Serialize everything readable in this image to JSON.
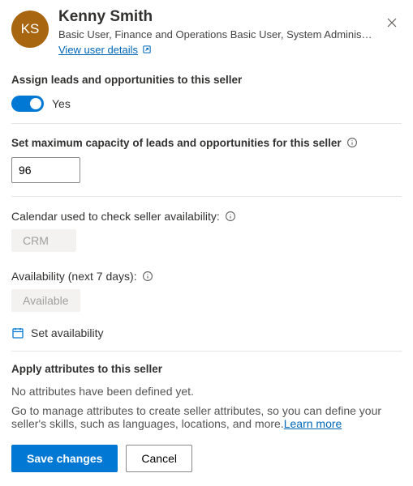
{
  "header": {
    "initials": "KS",
    "name": "Kenny Smith",
    "roles": "Basic User, Finance and Operations Basic User, System Administr…",
    "view_details_label": "View user details"
  },
  "assign": {
    "title": "Assign leads and opportunities to this seller",
    "toggle_label": "Yes"
  },
  "capacity": {
    "title": "Set maximum capacity of leads and opportunities for this seller",
    "value": "96"
  },
  "calendar": {
    "label": "Calendar used to check seller availability:",
    "value": "CRM"
  },
  "availability": {
    "label": "Availability (next 7 days):",
    "value": "Available",
    "set_label": "Set availability"
  },
  "attributes": {
    "title": "Apply attributes to this seller",
    "none_text": "No attributes have been defined yet.",
    "hint_text": "Go to manage attributes to create seller attributes, so you can define your seller's skills, such as languages, locations, and more.",
    "learn_more": "Learn more"
  },
  "footer": {
    "save": "Save changes",
    "cancel": "Cancel"
  }
}
